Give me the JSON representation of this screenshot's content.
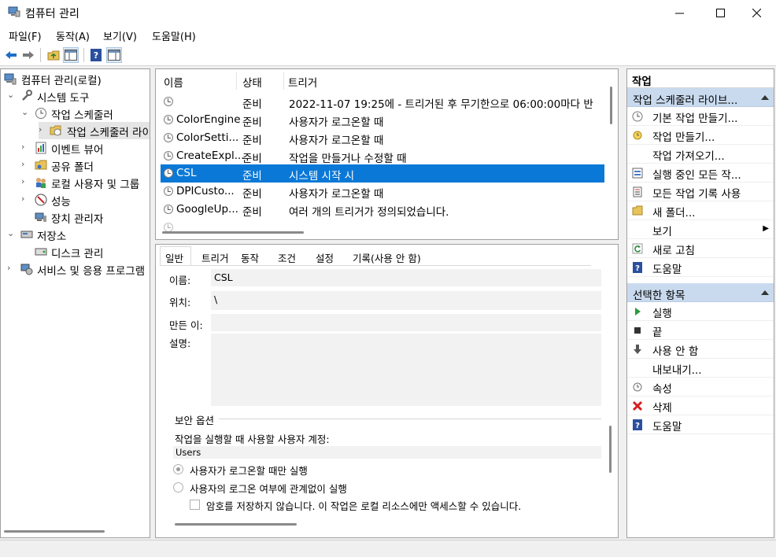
{
  "window": {
    "title": "컴퓨터 관리",
    "minimize": "—",
    "maximize": "☐",
    "close": "✕"
  },
  "menu": [
    "파일(F)",
    "동작(A)",
    "보기(V)",
    "도움말(H)"
  ],
  "tree": [
    {
      "label": "컴퓨터 관리(로컬)",
      "icon": "computer-management-icon"
    },
    {
      "label": "시스템 도구",
      "icon": "tools-icon",
      "arrow": "⌄"
    },
    {
      "label": "작업 스케줄러",
      "icon": "clock-icon",
      "arrow": "⌄"
    },
    {
      "label": "작업 스케줄러 라이브러리",
      "icon": "folder-clock-icon",
      "arrow": "›"
    },
    {
      "label": "이벤트 뷰어",
      "icon": "event-viewer-icon",
      "arrow": "›"
    },
    {
      "label": "공유 폴더",
      "icon": "shared-folder-icon",
      "arrow": "›"
    },
    {
      "label": "로컬 사용자 및 그룹",
      "icon": "users-icon",
      "arrow": "›"
    },
    {
      "label": "성능",
      "icon": "performance-icon",
      "arrow": "›"
    },
    {
      "label": "장치 관리자",
      "icon": "device-manager-icon"
    },
    {
      "label": "저장소",
      "icon": "storage-icon",
      "arrow": "⌄"
    },
    {
      "label": "디스크 관리",
      "icon": "disk-icon"
    },
    {
      "label": "서비스 및 응용 프로그램",
      "icon": "services-icon",
      "arrow": "›"
    }
  ],
  "task_list": {
    "headers": [
      "이름",
      "상태",
      "트리거"
    ],
    "rows": [
      {
        "name": "",
        "status": "준비",
        "trigger": "2022-11-07 19:25에 - 트리거된 후 무기한으로 06:00:00마다 반"
      },
      {
        "name": "ColorEngine",
        "status": "준비",
        "trigger": "사용자가 로그온할 때"
      },
      {
        "name": "ColorSetti...",
        "status": "준비",
        "trigger": "사용자가 로그온할 때"
      },
      {
        "name": "CreateExpl...",
        "status": "준비",
        "trigger": "작업을 만들거나 수정할 때"
      },
      {
        "name": "CSL",
        "status": "준비",
        "trigger": "시스템 시작 시",
        "selected": true
      },
      {
        "name": "DPICusto...",
        "status": "준비",
        "trigger": "사용자가 로그온할 때"
      },
      {
        "name": "GoogleUp...",
        "status": "준비",
        "trigger": "여러 개의 트리거가 정의되었습니다."
      },
      {
        "name": "",
        "status": "",
        "trigger": ""
      }
    ]
  },
  "detail": {
    "tabs": [
      "일반",
      "트리거",
      "동작",
      "조건",
      "설정",
      "기록(사용 안 함)"
    ],
    "name_label": "이름:",
    "name_value": "CSL",
    "location_label": "위치:",
    "location_value": "\\",
    "author_label": "만든 이:",
    "description_label": "설명:",
    "security_title": "보안 옵션",
    "account_prompt": "작업을 실행할 때 사용할 사용자 계정:",
    "account_value": "Users",
    "radio_logged_on": "사용자가 로그온할 때만 실행",
    "radio_whether": "사용자의 로그온 여부에 관계없이 실행",
    "checkbox_no_password": "암호를 저장하지 않습니다. 이 작업은 로컬 리소스에만 액세스할 수 있습니다."
  },
  "actions": {
    "header": "작업",
    "section1": "작업 스케줄러 라이브...",
    "items1": [
      {
        "label": "기본 작업 만들기...",
        "icon": "create-basic-task-icon"
      },
      {
        "label": "작업 만들기...",
        "icon": "create-task-icon"
      },
      {
        "label": "작업 가져오기...",
        "icon": ""
      },
      {
        "label": "실행 중인 모든 작...",
        "icon": "running-tasks-icon"
      },
      {
        "label": "모든 작업 기록 사용",
        "icon": "history-icon"
      },
      {
        "label": "새 폴더...",
        "icon": "new-folder-icon"
      },
      {
        "label": "보기",
        "icon": "",
        "submenu": "▶"
      },
      {
        "label": "새로 고침",
        "icon": "refresh-icon"
      },
      {
        "label": "도움말",
        "icon": "help-icon"
      }
    ],
    "section2": "선택한 항목",
    "items2": [
      {
        "label": "실행",
        "icon": "run-icon"
      },
      {
        "label": "끝",
        "icon": "end-icon"
      },
      {
        "label": "사용 안 함",
        "icon": "disable-icon"
      },
      {
        "label": "내보내기...",
        "icon": ""
      },
      {
        "label": "속성",
        "icon": "properties-icon"
      },
      {
        "label": "삭제",
        "icon": "delete-icon"
      },
      {
        "label": "도움말",
        "icon": "help-icon"
      }
    ]
  }
}
